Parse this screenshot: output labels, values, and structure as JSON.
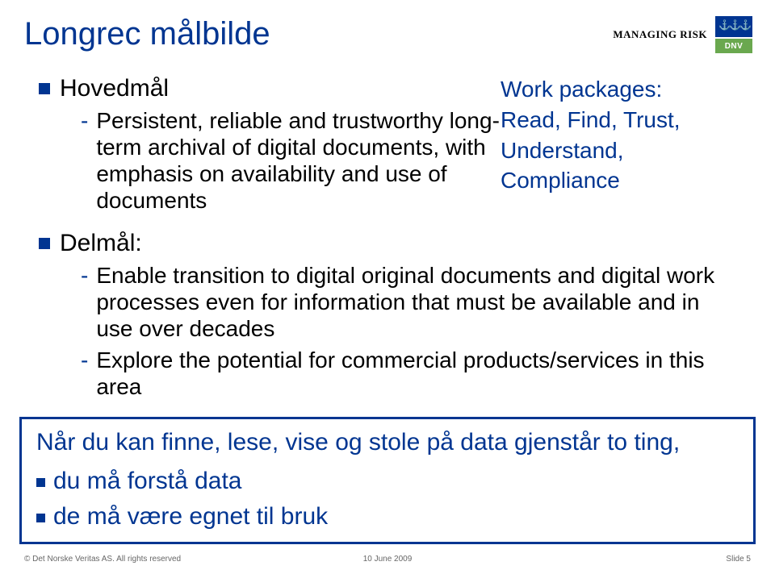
{
  "header": {
    "managing": "MANAGING RISK",
    "logo_text": "DNV"
  },
  "title": "Longrec målbilde",
  "hovedmal": {
    "label": "Hovedmål",
    "sub1": "Persistent, reliable and trustworthy long-term archival of digital documents, with emphasis on availability and use of documents"
  },
  "wp": {
    "line1": "Work packages:",
    "line2": "Read, Find, Trust,",
    "line3": "Understand, Compliance"
  },
  "delmal": {
    "label": "Delmål:",
    "sub1": "Enable transition to digital original documents and digital work processes even for information that must be available and in use over decades",
    "sub2": "Explore the potential for commercial products/services in this area"
  },
  "callout": {
    "line1": "Når du kan finne, lese, vise og stole på data gjenstår to ting,",
    "item1": "du må forstå data",
    "item2": "de må være egnet til bruk"
  },
  "footer": {
    "left": "© Det Norske Veritas AS. All rights reserved",
    "center": "10 June 2009",
    "right": "Slide 5"
  }
}
